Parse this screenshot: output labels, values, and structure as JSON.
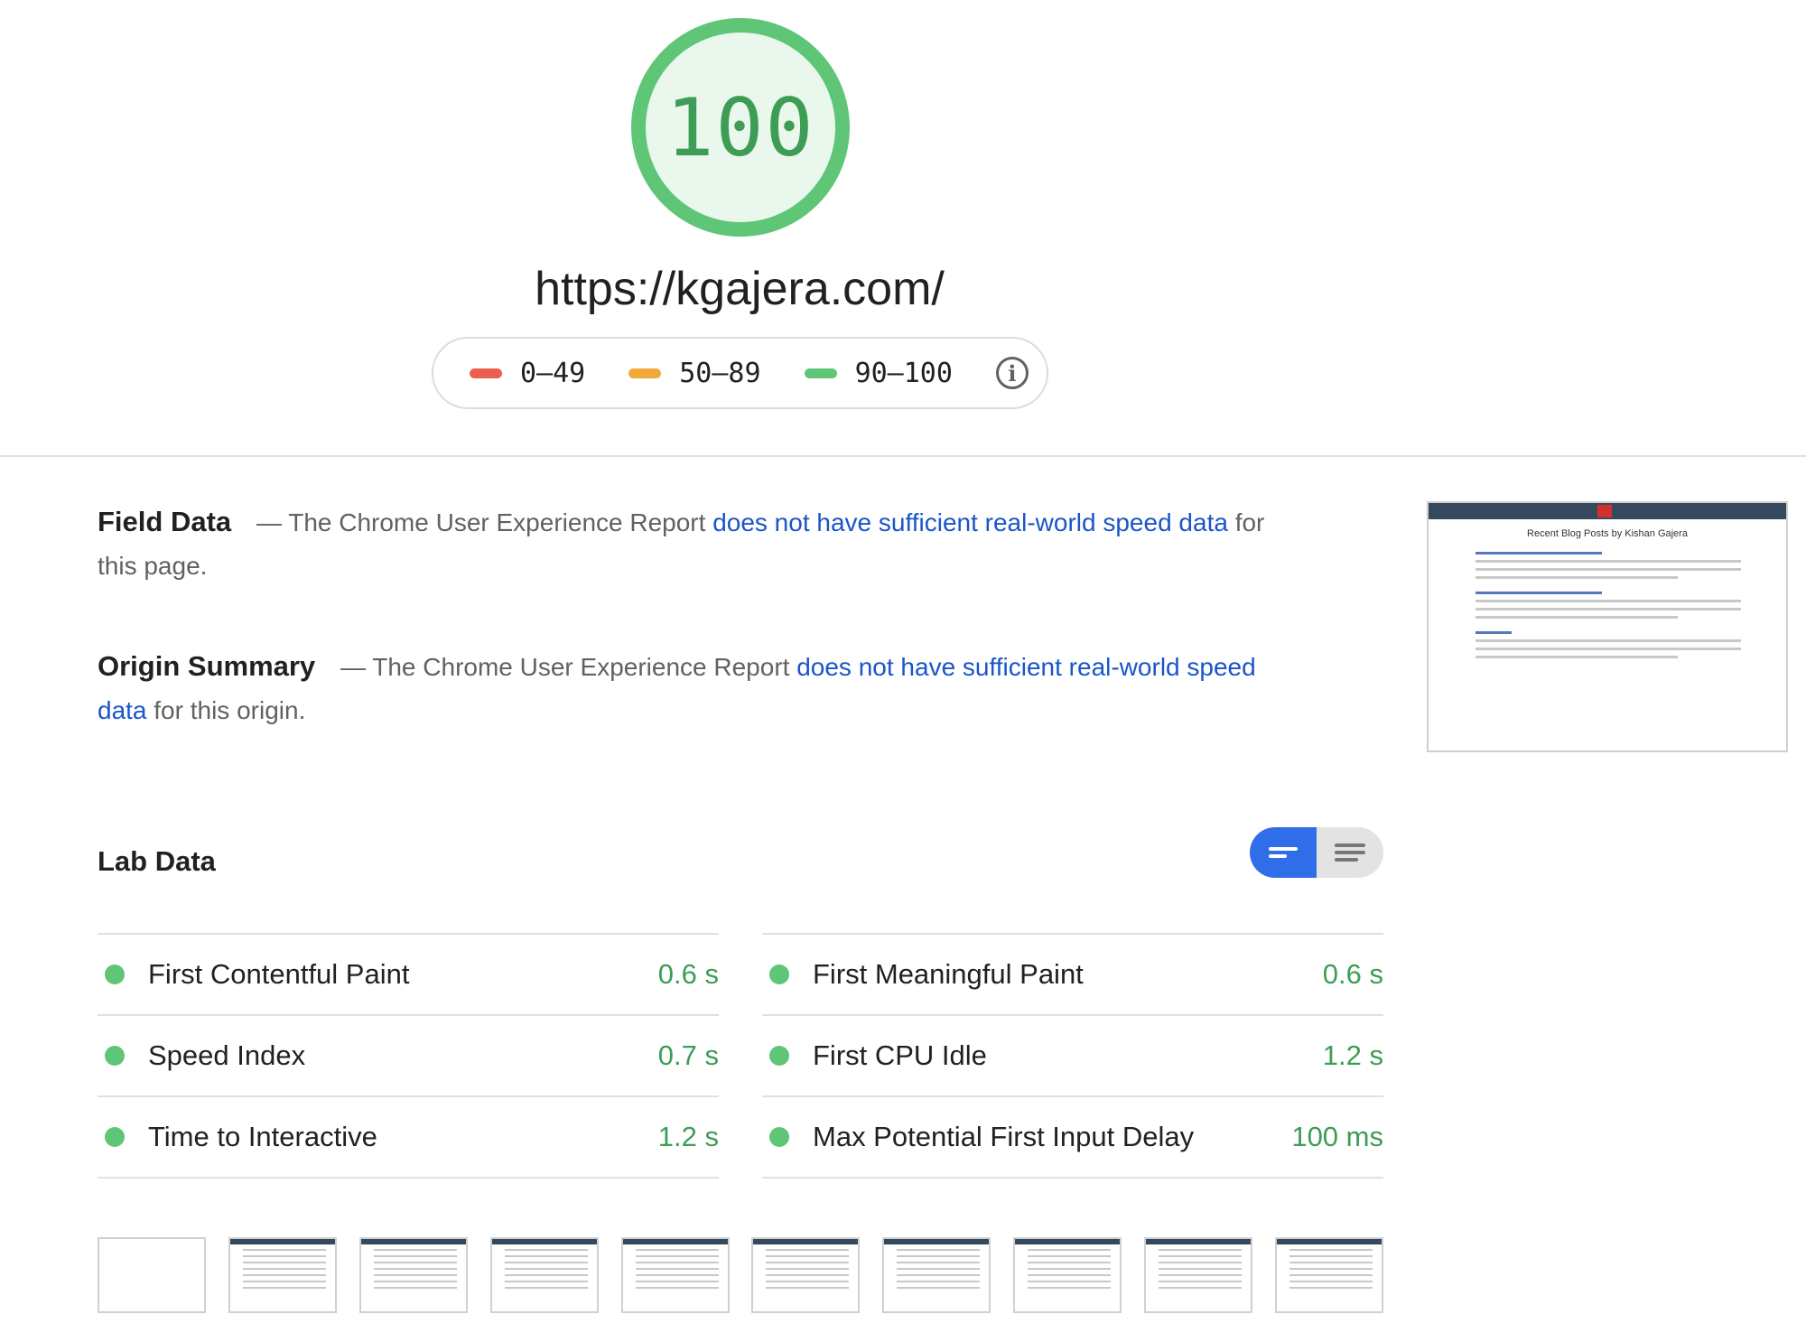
{
  "score": {
    "value": "100",
    "color": "#5ec676"
  },
  "url": "https://kgajera.com/",
  "legend": {
    "items": [
      {
        "label": "0–49",
        "color": "#eb5f4f"
      },
      {
        "label": "50–89",
        "color": "#f2a93b"
      },
      {
        "label": "90–100",
        "color": "#5ec676"
      }
    ],
    "info_icon": "info-icon"
  },
  "field_data": {
    "heading": "Field Data",
    "prefix": "— The Chrome User Experience Report",
    "link": "does not have sufficient real-world speed data",
    "suffix": "for this page."
  },
  "origin_summary": {
    "heading": "Origin Summary",
    "prefix": "— The Chrome User Experience Report",
    "link": "does not have sufficient real-world speed data",
    "suffix": "for this origin."
  },
  "thumbnail": {
    "title": "Recent Blog Posts by Kishan Gajera"
  },
  "lab_data": {
    "title": "Lab Data",
    "metrics": [
      {
        "label": "First Contentful Paint",
        "value": "0.6 s"
      },
      {
        "label": "First Meaningful Paint",
        "value": "0.6 s"
      },
      {
        "label": "Speed Index",
        "value": "0.7 s"
      },
      {
        "label": "First CPU Idle",
        "value": "1.2 s"
      },
      {
        "label": "Time to Interactive",
        "value": "1.2 s"
      },
      {
        "label": "Max Potential First Input Delay",
        "value": "100 ms"
      }
    ]
  }
}
